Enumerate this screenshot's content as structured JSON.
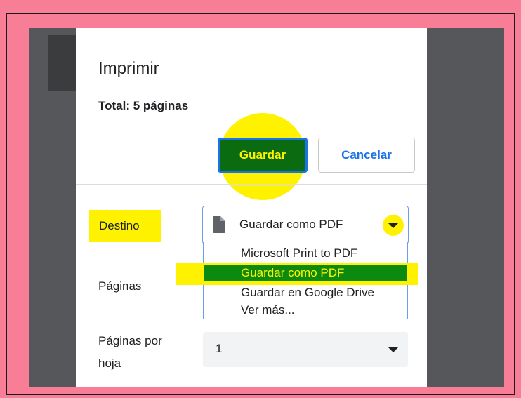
{
  "dialog": {
    "title": "Imprimir",
    "total": "Total: 5 páginas",
    "save_label": "Guardar",
    "cancel_label": "Cancelar"
  },
  "destination": {
    "label": "Destino",
    "selected": "Guardar como PDF",
    "icon": "document-icon",
    "options": [
      {
        "label": "Microsoft Print to PDF"
      },
      {
        "label": "Guardar como PDF",
        "selected": true
      },
      {
        "label": "Guardar en Google Drive"
      },
      {
        "label": "Ver más..."
      }
    ]
  },
  "pages": {
    "label": "Páginas"
  },
  "pages_per_sheet": {
    "label_line1": "Páginas por",
    "label_line2": "hoja",
    "value": "1"
  },
  "colors": {
    "highlight": "#fff200",
    "save_button_bg": "#0b6b11",
    "selected_option_bg": "#0b8a0f",
    "accent_blue": "#1a73e8",
    "outer_background": "#f77e96",
    "backdrop": "#55575a"
  }
}
